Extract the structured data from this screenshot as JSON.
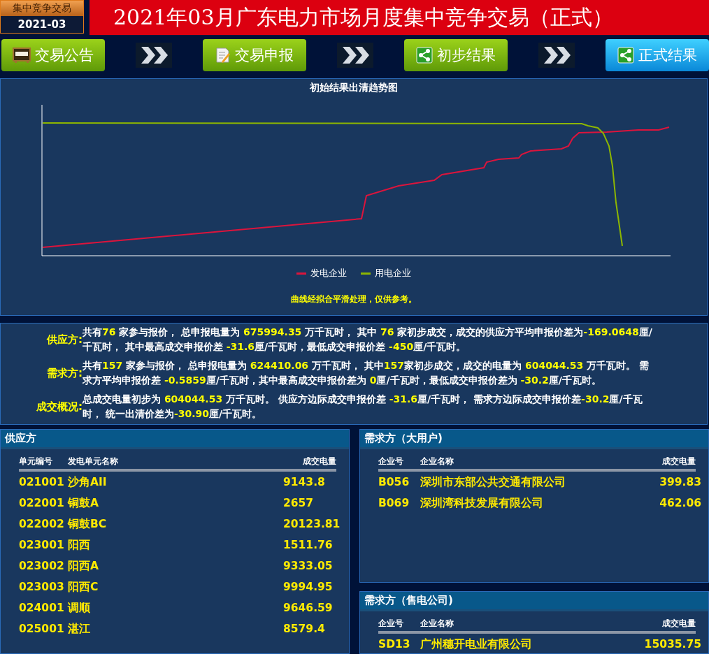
{
  "header": {
    "badge_title": "集中竞争交易",
    "badge_date": "2021-03",
    "title": "2021年03月广东电力市场月度集中竞争交易（正式）"
  },
  "nav": [
    {
      "label": "交易公告",
      "kind": "notice",
      "selected": false
    },
    {
      "label": "交易申报",
      "kind": "form",
      "selected": false
    },
    {
      "label": "初步结果",
      "kind": "share",
      "selected": false
    },
    {
      "label": "正式结果",
      "kind": "share",
      "selected": true
    }
  ],
  "chart": {
    "title": "初始结果出清趋势图",
    "legend": [
      {
        "label": "发电企业",
        "color": "#dc143c"
      },
      {
        "label": "用电企业",
        "color": "#8db600"
      }
    ],
    "note": "曲线经拟合平滑处理，仅供参考。"
  },
  "summary": [
    {
      "label": "供应方:",
      "text": "共有**76** 家参与报价， 总申报电量为 **675994.35** 万千瓦时， 其中 **76** 家初步成交，成交的供应方平均申报价差为**-169.0648**厘/千瓦时， 其中最高成交申报价差 **-31.6**厘/千瓦时，最低成交申报价差 **-450**厘/千瓦时。"
    },
    {
      "label": "需求方:",
      "text": "共有**157** 家参与报价， 总申报电量为 **624410.06** 万千瓦时， 其中**157**家初步成交，成交的电量为 **604044.53** 万千瓦时。 需求方平均申报价差 **-0.5859**厘/千瓦时，其中最高成交申报价差为 **0**厘/千瓦时，最低成交申报价差为 **-30.2**厘/千瓦时。"
    },
    {
      "label": "成交概况:",
      "text": "总成交电量初步为 **604044.53** 万千瓦时。 供应方边际成交申报价差 **-31.6**厘/千瓦时， 需求方边际成交申报价差**-30.2**厘/千瓦时， 统一出清价差为**-30.90**厘/千瓦时。"
    }
  ],
  "supply": {
    "title": "供应方",
    "columns": [
      "单元编号",
      "发电单元名称",
      "成交电量"
    ],
    "rows": [
      [
        "021001",
        "沙角AII",
        "9143.8"
      ],
      [
        "022001",
        "铜鼓A",
        "2657"
      ],
      [
        "022002",
        "铜鼓BC",
        "20123.81"
      ],
      [
        "023001",
        "阳西",
        "1511.76"
      ],
      [
        "023002",
        "阳西A",
        "9333.05"
      ],
      [
        "023003",
        "阳西C",
        "9994.95"
      ],
      [
        "024001",
        "调顺",
        "9646.59"
      ],
      [
        "025001",
        "湛江",
        "8579.4"
      ]
    ]
  },
  "large_users": {
    "title": "需求方（大用户)",
    "columns": [
      "企业号",
      "企业名称",
      "成交电量"
    ],
    "rows": [
      [
        "B056",
        "深圳市东部公共交通有限公司",
        "399.83"
      ],
      [
        "B069",
        "深圳湾科技发展有限公司",
        "462.06"
      ]
    ]
  },
  "retailers": {
    "title": "需求方（售电公司)",
    "columns": [
      "企业号",
      "企业名称",
      "成交电量"
    ],
    "rows": [
      [
        "SD13",
        "广州穗开电业有限公司",
        "15035.75"
      ]
    ]
  }
}
